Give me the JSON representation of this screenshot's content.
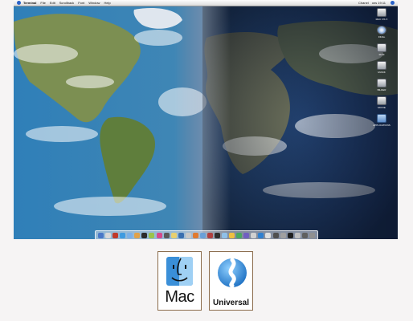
{
  "menubar": {
    "app_name": "Terminal",
    "menus": [
      "File",
      "Edit",
      "Scrollback",
      "Font",
      "Window",
      "Help"
    ],
    "status_name": "Chanel",
    "clock": "ons 19:11"
  },
  "desktop": {
    "icons": [
      {
        "name": "MAC OS X",
        "icon": "hard-drive-icon"
      },
      {
        "name": "FINAL",
        "icon": "disc-icon"
      },
      {
        "name": "FILM",
        "icon": "hard-drive-icon"
      },
      {
        "name": "MUSIK",
        "icon": "hard-drive-icon"
      },
      {
        "name": "BILDER",
        "icon": "hard-drive-icon"
      },
      {
        "name": "MOVIE",
        "icon": "hard-drive-icon"
      },
      {
        "name": "APPLICATIONS",
        "icon": "folder-icon"
      }
    ]
  },
  "dock": {
    "colors": [
      "#4a78c8",
      "#d9d9d9",
      "#c03a2b",
      "#3f9be0",
      "#7bb0e8",
      "#e0a24a",
      "#2b2b2b",
      "#9bc34a",
      "#d44a8c",
      "#5a5a5a",
      "#e8d070",
      "#3a6fb0",
      "#c9c9c9",
      "#e07a30",
      "#6aa0d8",
      "#b04040",
      "#2f2f2f",
      "#8fc0e8",
      "#f0c040",
      "#4aa860",
      "#7060c0",
      "#d0d0d0",
      "#3080d0",
      "#e0e0e0",
      "#505050",
      "#a0a0a0",
      "#202020",
      "#c0c0c0",
      "#606060",
      "#909090"
    ]
  },
  "badges": {
    "mac": {
      "label": "Mac",
      "icon": "finder-icon"
    },
    "universal": {
      "label": "Universal",
      "icon": "universal-icon"
    }
  }
}
